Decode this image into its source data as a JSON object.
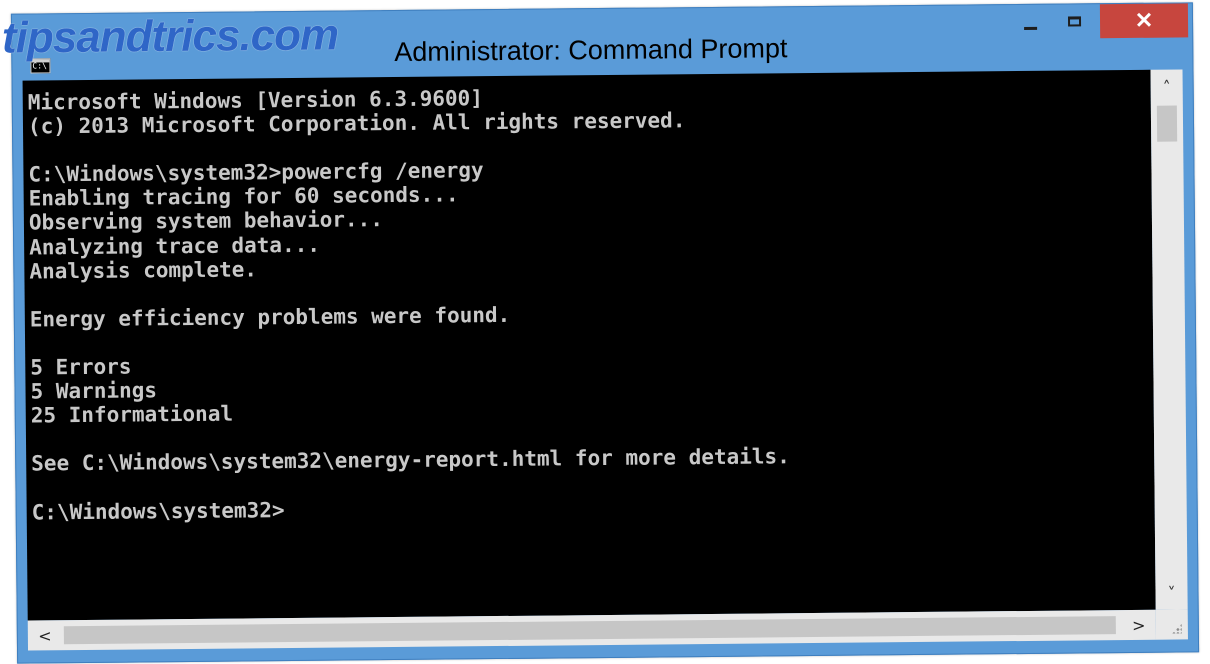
{
  "watermark": "tipsandtrics.com",
  "window": {
    "title": "Administrator: Command Prompt",
    "icon": "cmd-icon",
    "icon_text": "C:\\",
    "minimize": "minimize-icon",
    "maximize": "maximize-icon",
    "close_label": "✕"
  },
  "console": {
    "background": "#000000",
    "foreground": "#c0c0c0",
    "lines": [
      "Microsoft Windows [Version 6.3.9600]",
      "(c) 2013 Microsoft Corporation. All rights reserved.",
      "",
      "C:\\Windows\\system32>powercfg /energy",
      "Enabling tracing for 60 seconds...",
      "Observing system behavior...",
      "Analyzing trace data...",
      "Analysis complete.",
      "",
      "Energy efficiency problems were found.",
      "",
      "5 Errors",
      "5 Warnings",
      "25 Informational",
      "",
      "See C:\\Windows\\system32\\energy-report.html for more details.",
      "",
      "C:\\Windows\\system32>"
    ]
  },
  "scrollbars": {
    "up_arrow": "˄",
    "down_arrow": "˅",
    "left_arrow": "<",
    "right_arrow": ">"
  },
  "colors": {
    "title_bar": "#5a9bd8",
    "close_button": "#c7463e",
    "watermark": "#2f66c7"
  }
}
